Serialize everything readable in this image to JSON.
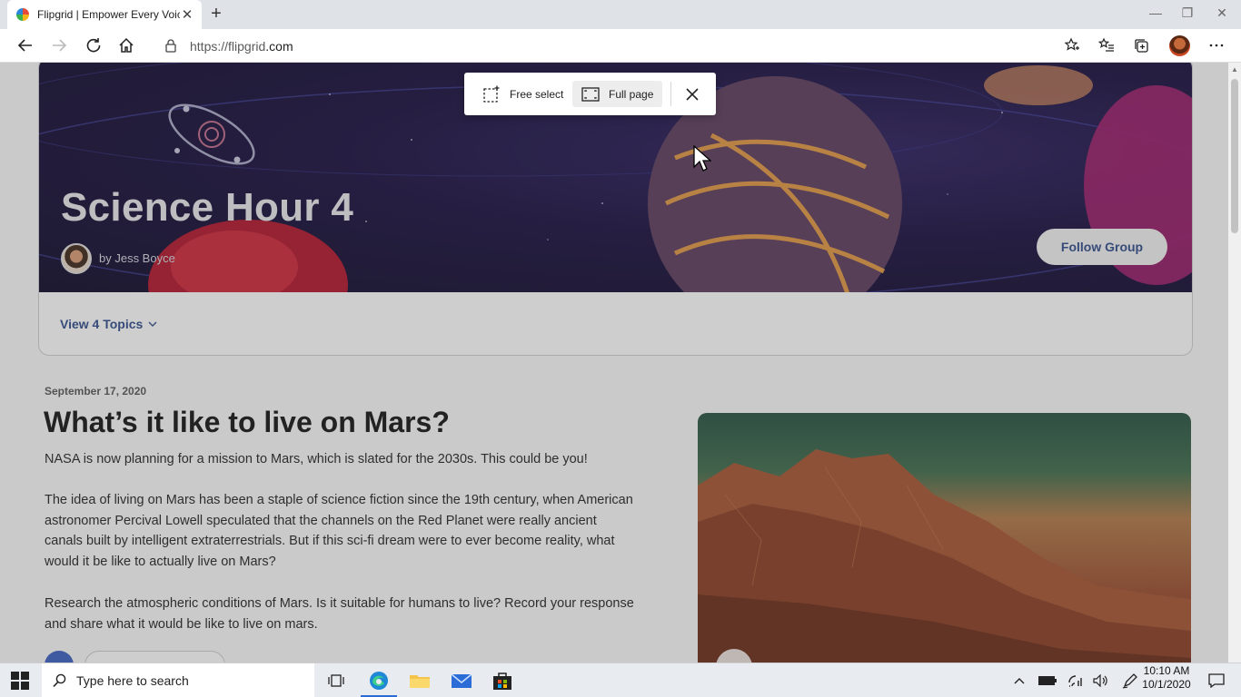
{
  "browser": {
    "tab_title": "Flipgrid | Empower Every Voice",
    "tab_close": "✕",
    "new_tab": "+",
    "url_prefix": "https://flipgrid",
    "url_domain": ".com"
  },
  "capture_toolbar": {
    "free_select_label": "Free select",
    "full_page_label": "Full page",
    "selected": "Full page"
  },
  "group": {
    "title": "Science Hour 4",
    "author": "by Jess Boyce",
    "follow_label": "Follow Group",
    "topics_label": "View 4 Topics"
  },
  "topic": {
    "date": "September 17, 2020",
    "title": "What’s it like to live on Mars?",
    "paragraphs": [
      "NASA is now planning for a mission to Mars, which is slated for the 2030s. This could be you!",
      "The idea of living on Mars has been a staple of science fiction since the 19th century, when American astronomer Percival Lowell speculated that the channels on the Red Planet were really ancient canals built by intelligent extraterrestrials. But if this sci-fi dream were to ever become reality, what would it be like to actually live on Mars?",
      "Research the atmospheric conditions of Mars. Is it suitable for humans to live? Record your response and share what it would be like to live on mars."
    ]
  },
  "taskbar": {
    "search_placeholder": "Type here to search",
    "time": "10:10 AM",
    "date": "10/1/2020"
  },
  "colors": {
    "accent_blue": "#2d4a8a",
    "hero_bg": "#160c3c"
  }
}
